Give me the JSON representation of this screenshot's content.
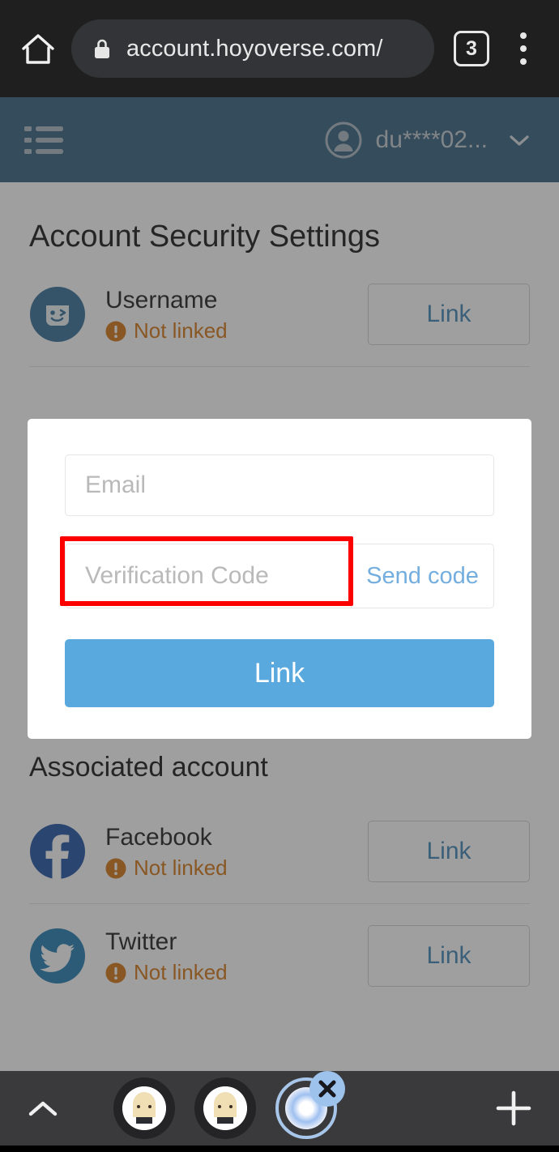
{
  "browser": {
    "home_icon": "home-icon",
    "lock_icon": "lock-icon",
    "url": "account.hoyoverse.com/",
    "tab_count": "3",
    "menu_icon": "kebab-menu-icon"
  },
  "site_header": {
    "menu_icon": "list-menu-icon",
    "avatar_icon": "user-avatar-icon",
    "account_name": "du****02...",
    "chevron_icon": "chevron-down-icon"
  },
  "page": {
    "title": "Account Security Settings",
    "security_accounts": [
      {
        "icon": "username-face-icon",
        "name": "Username",
        "status": "Not linked",
        "status_icon": "warning-icon",
        "action": "Link"
      }
    ],
    "associated_section_title": "Associated account",
    "associated_accounts": [
      {
        "icon": "facebook-icon",
        "name": "Facebook",
        "status": "Not linked",
        "status_icon": "warning-icon",
        "action": "Link"
      },
      {
        "icon": "twitter-icon",
        "name": "Twitter",
        "status": "Not linked",
        "status_icon": "warning-icon",
        "action": "Link"
      }
    ]
  },
  "modal": {
    "email_placeholder": "Email",
    "email_value": "",
    "code_placeholder": "Verification Code",
    "code_value": "",
    "send_code_label": "Send code",
    "submit_label": "Link"
  },
  "dock": {
    "expand_icon": "chevron-up-icon",
    "apps": [
      {
        "icon": "character-avatar-icon",
        "active": false
      },
      {
        "icon": "character-avatar-icon",
        "active": false
      },
      {
        "icon": "app-orb-icon",
        "active": true,
        "close_icon": "close-icon"
      }
    ],
    "add_icon": "plus-icon"
  },
  "colors": {
    "header_blue": "#2d5d7c",
    "accent_blue": "#5aa9de",
    "link_blue": "#3b82b4",
    "warning_orange": "#d4720d",
    "annotation_red": "#fc0000",
    "facebook_blue": "#1a4fa3",
    "twitter_blue": "#1d7ab0"
  }
}
